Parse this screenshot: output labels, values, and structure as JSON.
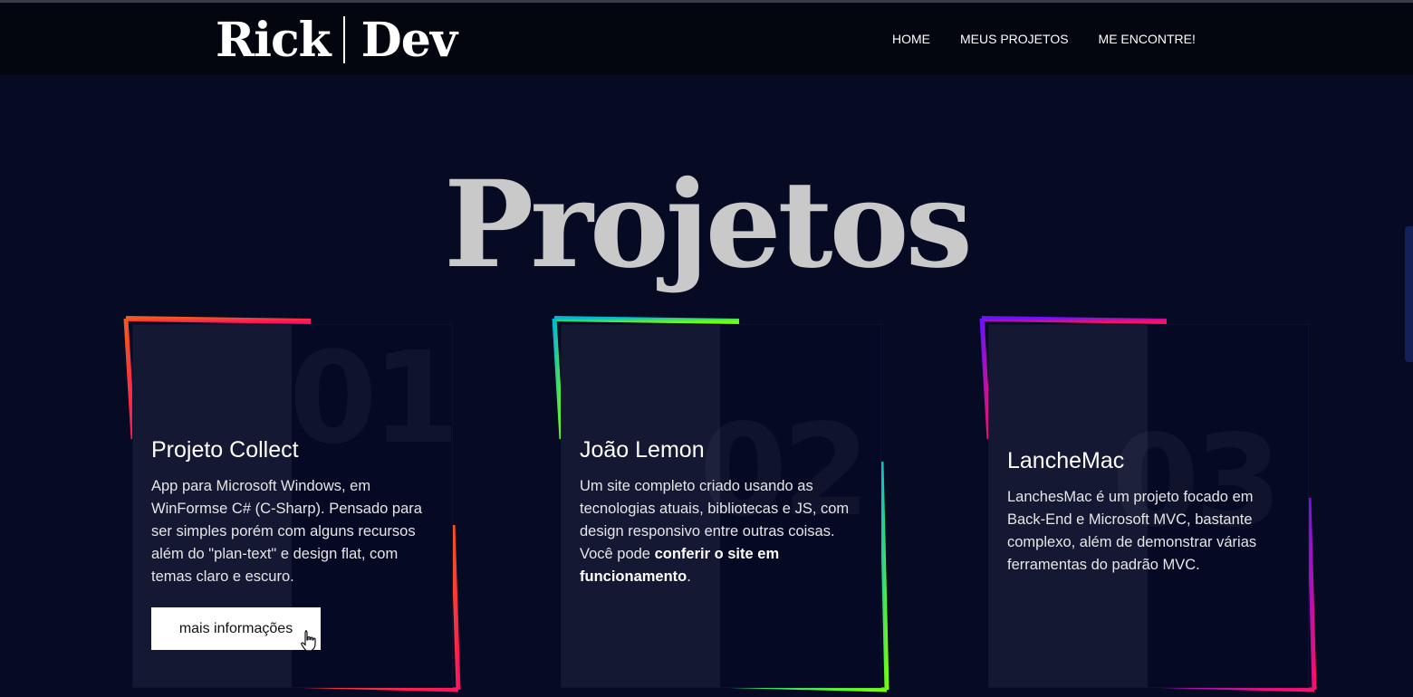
{
  "brand": {
    "left": "Rick",
    "right": "Dev"
  },
  "nav": {
    "home": "HOME",
    "projects": "MEUS PROJETOS",
    "contact": "ME ENCONTRE!"
  },
  "page_title": "Projetos",
  "projects": [
    {
      "number": "01",
      "title": "Projeto Collect",
      "description": "App para Microsoft Windows, em WinFormse C# (C-Sharp). Pensado para ser simples porém com alguns recursos além do \"plan-text\" e design flat, com temas claro e escuro.",
      "button": "mais informações",
      "gradient": [
        "#f05a1e",
        "#ff1060"
      ]
    },
    {
      "number": "02",
      "title": "João Lemon",
      "description_prefix": "Um site completo criado usando as tecnologias atuais, bibliotecas e JS, com design responsivo entre outras coisas. Você pode ",
      "description_link": "conferir o site em funcionamento",
      "description_suffix": ".",
      "gradient": [
        "#00b8d4",
        "#76ff03"
      ]
    },
    {
      "number": "03",
      "title": "LancheMac",
      "description": "LanchesMac é um projeto focado em Back-End e Microsoft MVC, bastante complexo, além de demonstrar várias ferramentas do padrão MVC.",
      "gradient": [
        "#6a11ff",
        "#ff1060"
      ]
    }
  ],
  "colors": {
    "background": "#060a22",
    "navbar": "#03050f",
    "title": "#c9c9c9"
  }
}
